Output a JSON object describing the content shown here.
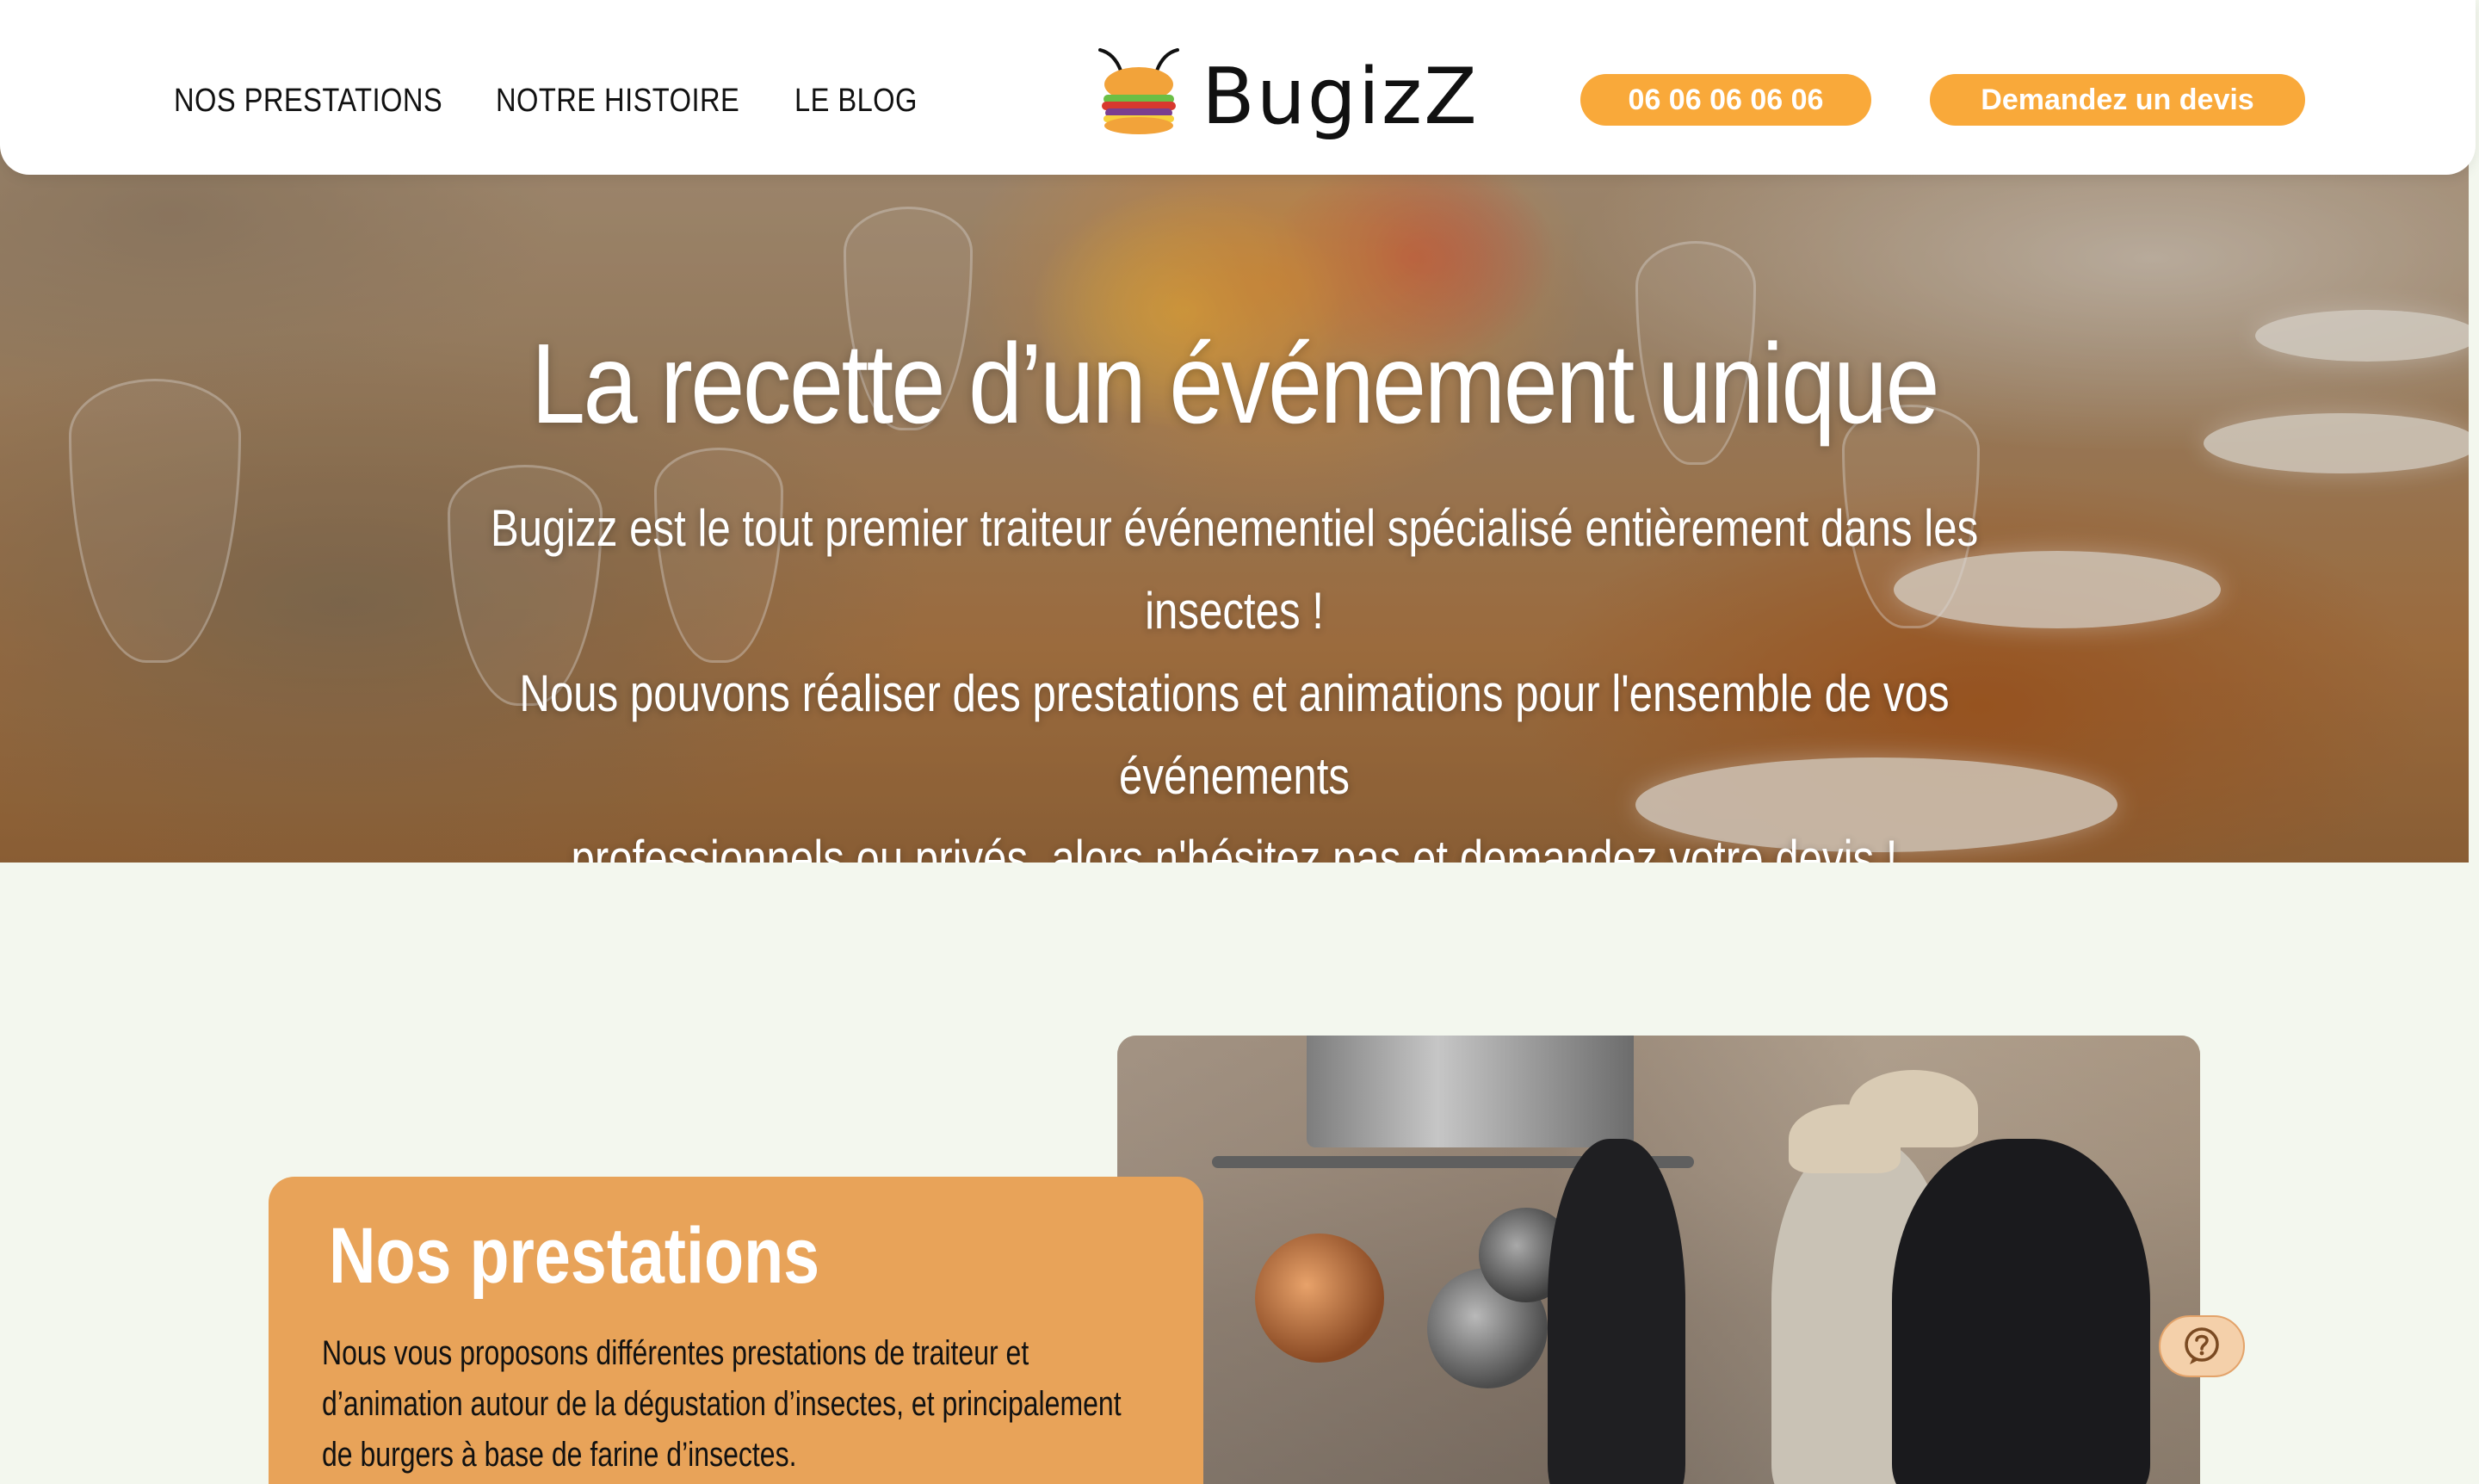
{
  "header": {
    "nav": [
      "NOS PRESTATIONS",
      "NOTRE HISTOIRE",
      "LE BLOG"
    ],
    "logo_text": "BugizZ",
    "phone_label": "06 06 06 06 06",
    "quote_button_label": "Demandez un devis"
  },
  "hero": {
    "title": "La recette d’un événement unique",
    "lines": [
      "Bugizz est le tout premier traiteur événementiel spécialisé entièrement dans les insectes !",
      "Nous pouvons réaliser des prestations et animations pour l'ensemble de vos événements",
      "professionnels ou privés, alors n'hésitez pas et demandez votre devis !"
    ]
  },
  "prestations": {
    "title": "Nos prestations",
    "lines": [
      "Nous vous proposons différentes prestations de traiteur et",
      "d’animation autour de la dégustation d’insectes, et principalement",
      "de burgers à base de farine d’insectes."
    ]
  },
  "colors": {
    "accent_orange": "#f9a93a",
    "card_orange": "#e8a359",
    "page_background": "#f3f7ee"
  },
  "icons": {
    "logo": "bee-burger-icon",
    "help": "question-bubble-icon"
  }
}
